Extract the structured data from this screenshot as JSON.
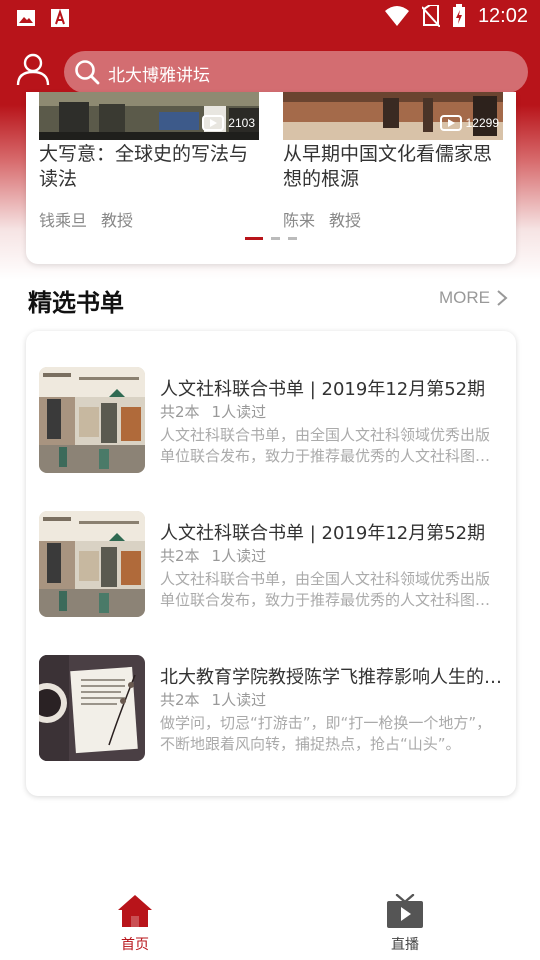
{
  "status_bar": {
    "time": "12:02",
    "icons_left": [
      "image-icon",
      "app-a-icon"
    ],
    "icons_right": [
      "wifi-icon",
      "no-sim-icon",
      "battery-charging-icon"
    ]
  },
  "header": {
    "search_placeholder": "北大博雅讲坛"
  },
  "lectures": [
    {
      "count": "2103",
      "title": "大写意：全球史的写法与读法",
      "author": "钱乘旦",
      "role": "教授"
    },
    {
      "count": "12299",
      "title": "从早期中国文化看儒家思想的根源",
      "author": "陈来",
      "role": "教授"
    }
  ],
  "carousel": {
    "total": 3,
    "active": 0
  },
  "booklists": {
    "title": "精选书单",
    "more": "MORE",
    "items": [
      {
        "title": "人文社科联合书单 | 2019年12月第52期",
        "count": "共2本",
        "readers": "1人读过",
        "desc": "人文社科联合书单，由全国人文社科领域优秀出版单位联合发布，致力于推荐最优秀的人文社科图书。"
      },
      {
        "title": "人文社科联合书单 | 2019年12月第52期",
        "count": "共2本",
        "readers": "1人读过",
        "desc": "人文社科联合书单，由全国人文社科领域优秀出版单位联合发布，致力于推荐最优秀的人文社科图书。"
      },
      {
        "title": "北大教育学院教授陈学飞推荐影响人生的书单",
        "count": "共2本",
        "readers": "1人读过",
        "desc": "做学问，切忌“打游击”，即“打一枪换一个地方”，不断地跟着风向转，捕捉热点，抢占“山头”。"
      }
    ]
  },
  "bottom_nav": [
    {
      "label": "首页",
      "icon": "home-icon",
      "active": true
    },
    {
      "label": "直播",
      "icon": "tv-live-icon",
      "active": false
    }
  ],
  "colors": {
    "brand": "#b8141a",
    "text": "#333333",
    "muted": "#999999"
  }
}
